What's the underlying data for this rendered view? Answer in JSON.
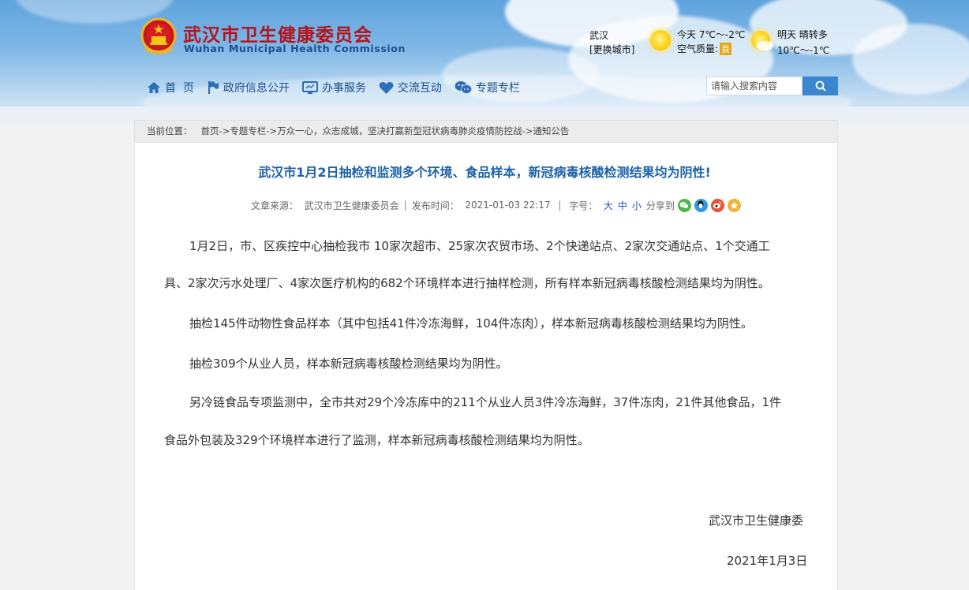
{
  "header": {
    "site_title": "武汉市卫生健康委员会",
    "site_subtitle": "Wuhan Municipal Health Commission"
  },
  "weather": {
    "city": "武汉",
    "switch_city": "[更换城市]",
    "today": "今天  7℃～-2℃",
    "air_quality_label": "空气质量:",
    "air_quality_value": "良",
    "tomorrow": "明天  晴转多",
    "tomorrow_temp": "10℃～-1℃"
  },
  "nav": {
    "items": [
      {
        "label": "首  页",
        "icon": "home-icon"
      },
      {
        "label": "政府信息公开",
        "icon": "flag-icon"
      },
      {
        "label": "办事服务",
        "icon": "monitor-icon"
      },
      {
        "label": "交流互动",
        "icon": "heart-icon"
      },
      {
        "label": "专题专栏",
        "icon": "chat-icon"
      }
    ]
  },
  "search": {
    "placeholder": "请输入搜索内容"
  },
  "breadcrumb": {
    "prefix": "当前位置：",
    "items": [
      "首页",
      "专题专栏",
      "万众一心，众志成城，坚决打赢新型冠状病毒肺炎疫情防控战",
      "通知公告"
    ]
  },
  "article": {
    "title": "武汉市1月2日抽检和监测多个环境、食品样本，新冠病毒核酸检测结果均为阴性!",
    "meta": {
      "source_label": "文章来源：",
      "source": "武汉市卫生健康委员会",
      "time_label": "发布时间：",
      "time": "2021-01-03 22:17",
      "fontsize_label": "字号：",
      "fontsize_options": [
        "大",
        "中",
        "小"
      ],
      "share_label": "分享到"
    },
    "lines": [
      "1月2日，市、区疾控中心抽检我市   10家次超市、25家次农贸市场、2个快递站点、2家次交通站点、1个交通工",
      "具、2家次污水处理厂、4家次医疗机构的682个环境样本进行抽样检测，所有样本新冠病毒核酸检测结果均为阴性。",
      "抽检145件动物性食品样本（其中包括41件冷冻海鲜，104件冻肉），样本新冠病毒核酸检测结果均为阴性。",
      "抽检309个从业人员，样本新冠病毒核酸检测结果均为阴性。",
      "另冷链食品专项监测中，全市共对29个冷冻库中的211个从业人员3件冷冻海鲜，37件冻肉，21件其他食品，1件",
      "食品外包装及329个环境样本进行了监测，样本新冠病毒核酸检测结果均为阴性。"
    ],
    "signature_org": "武汉市卫生健康委",
    "signature_date": "2021年1月3日"
  },
  "colors": {
    "title_red": "#b3141c",
    "nav_blue": "#1a4f8c",
    "article_title_blue": "#1c62a8",
    "search_button": "#3a86cf"
  }
}
